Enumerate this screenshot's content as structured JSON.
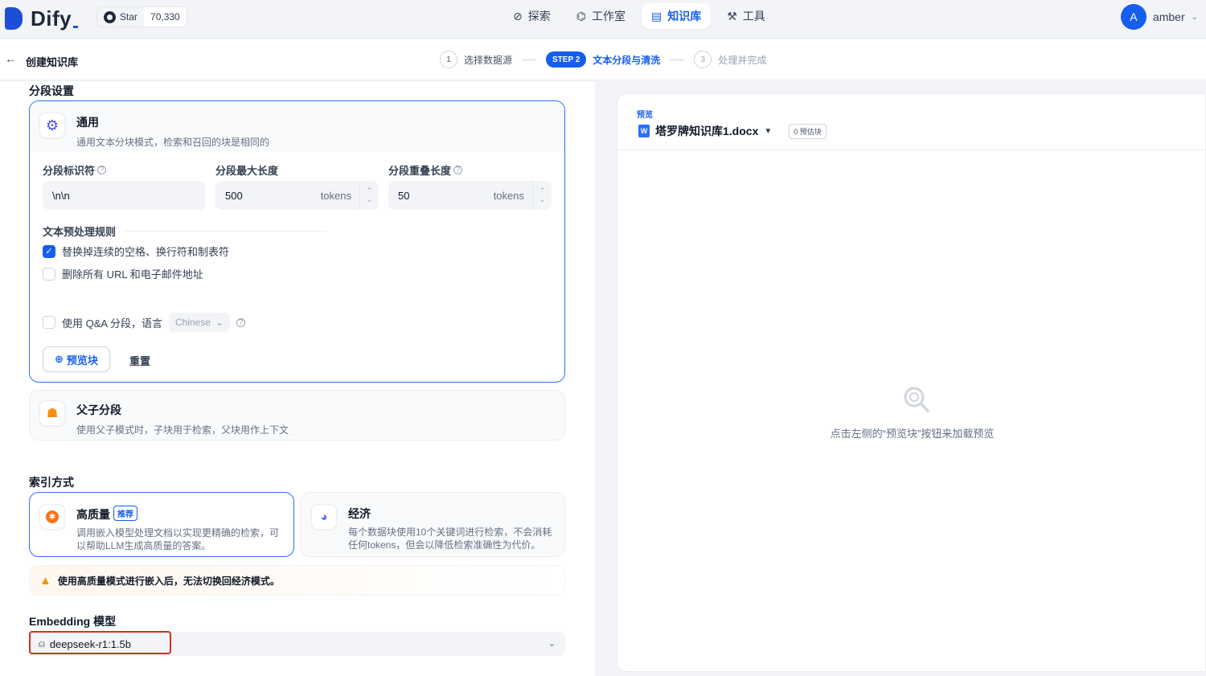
{
  "app": {
    "name": "Dify",
    "github": {
      "star_label": "Star",
      "star_count": "70,330"
    }
  },
  "nav": [
    {
      "label": "探索",
      "icon": "compass-icon",
      "active": false
    },
    {
      "label": "工作室",
      "icon": "robot-icon",
      "active": false
    },
    {
      "label": "知识库",
      "icon": "book-icon",
      "active": true
    },
    {
      "label": "工具",
      "icon": "tool-icon",
      "active": false
    }
  ],
  "user": {
    "initial": "A",
    "name": "amber"
  },
  "breadcrumb": {
    "title": "创建知识库"
  },
  "steps": [
    {
      "num": "1",
      "label": "选择数据源"
    },
    {
      "num": "STEP 2",
      "label": "文本分段与清洗"
    },
    {
      "num": "3",
      "label": "处理并完成"
    }
  ],
  "segment": {
    "section_title": "分段设置",
    "general": {
      "title": "通用",
      "desc": "通用文本分块模式，检索和召回的块是相同的",
      "identifier_label": "分段标识符",
      "identifier_value": "\\n\\n",
      "max_len_label": "分段最大长度",
      "max_len_value": "500",
      "overlap_label": "分段重叠长度",
      "overlap_value": "50",
      "unit": "tokens",
      "preprocess_title": "文本预处理规则",
      "rule_1": "替换掉连续的空格、换行符和制表符",
      "rule_1_checked": true,
      "rule_2": "删除所有 URL 和电子邮件地址",
      "rule_2_checked": false,
      "qa_label": "使用 Q&A 分段，语言",
      "qa_language": "Chinese",
      "preview_btn": "预览块",
      "reset_btn": "重置"
    },
    "parent_child": {
      "title": "父子分段",
      "desc": "使用父子模式时，子块用于检索，父块用作上下文"
    }
  },
  "index": {
    "section_title": "索引方式",
    "high_quality": {
      "title": "高质量",
      "badge": "推荐",
      "desc": "调用嵌入模型处理文档以实现更精确的检索，可以帮助LLM生成高质量的答案。"
    },
    "economy": {
      "title": "经济",
      "desc": "每个数据块使用10个关键词进行检索，不会消耗任何tokens，但会以降低检索准确性为代价。"
    },
    "warning": "使用高质量模式进行嵌入后，无法切换回经济模式。"
  },
  "embedding": {
    "title": "Embedding 模型",
    "model": "deepseek-r1:1.5b"
  },
  "preview": {
    "tag": "预览",
    "file": "塔罗牌知识库1.docx",
    "count": "0 预估块",
    "empty_text": "点击左侧的“预览块”按钮来加载预览"
  },
  "colors": {
    "accent": "#155eef",
    "warning": "#f79009",
    "highlight": "#d92d20"
  }
}
